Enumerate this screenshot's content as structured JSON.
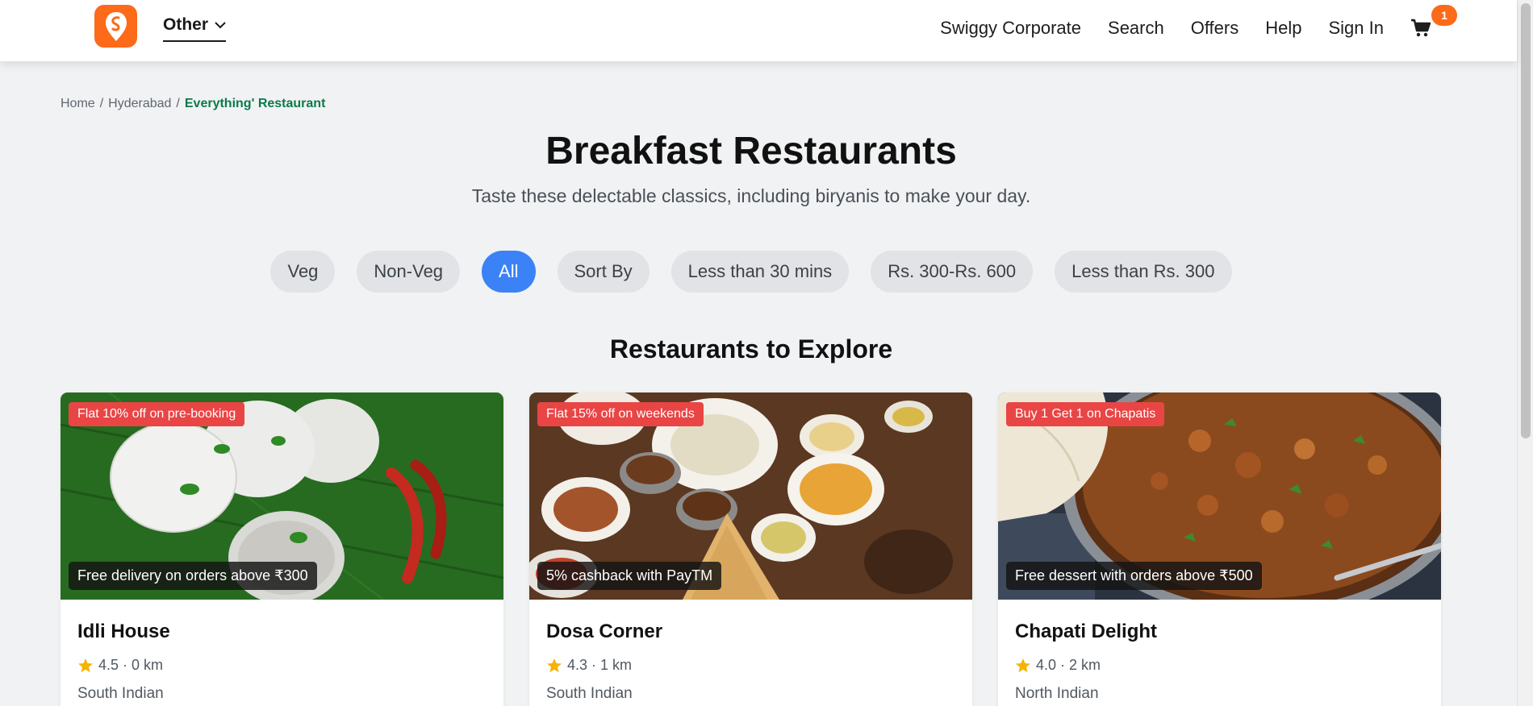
{
  "header": {
    "location_label": "Other",
    "nav": [
      {
        "label": "Swiggy Corporate"
      },
      {
        "label": "Search"
      },
      {
        "label": "Offers"
      },
      {
        "label": "Help"
      },
      {
        "label": "Sign In"
      }
    ],
    "cart_count": "1"
  },
  "breadcrumb": {
    "home": "Home",
    "city": "Hyderabad",
    "current": "Everything' Restaurant"
  },
  "hero": {
    "title": "Breakfast Restaurants",
    "subtitle": "Taste these delectable classics, including biryanis to make your day."
  },
  "filters": [
    {
      "label": "Veg",
      "active": false
    },
    {
      "label": "Non-Veg",
      "active": false
    },
    {
      "label": "All",
      "active": true
    },
    {
      "label": "Sort By",
      "active": false
    },
    {
      "label": "Less than 30 mins",
      "active": false
    },
    {
      "label": "Rs. 300-Rs. 600",
      "active": false
    },
    {
      "label": "Less than Rs. 300",
      "active": false
    }
  ],
  "section_title": "Restaurants to Explore",
  "restaurants": [
    {
      "name": "Idli House",
      "offer_top": "Flat 10% off on pre-booking",
      "offer_bottom": "Free delivery on orders above ₹300",
      "rating_distance": "4.5 · 0 km",
      "cuisine": "South Indian"
    },
    {
      "name": "Dosa Corner",
      "offer_top": "Flat 15% off on weekends",
      "offer_bottom": "5% cashback with PayTM",
      "rating_distance": "4.3 · 1 km",
      "cuisine": "South Indian"
    },
    {
      "name": "Chapati Delight",
      "offer_top": "Buy 1 Get 1 on Chapatis",
      "offer_bottom": "Free dessert with orders above ₹500",
      "rating_distance": "4.0 · 2 km",
      "cuisine": "North Indian"
    }
  ],
  "colors": {
    "brand": "#fc6a1a",
    "active_chip": "#3b82f6",
    "offer_badge": "#e94545",
    "breadcrumb_current": "#0b7a4b",
    "star": "#f5b400"
  },
  "icons": {
    "logo": "swiggy-logo-icon",
    "location_chevron": "chevron-down-icon",
    "cart": "cart-icon",
    "rating": "star-icon"
  }
}
